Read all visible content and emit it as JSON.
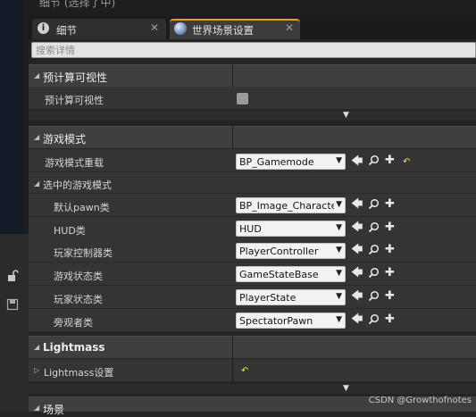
{
  "window": {
    "title_fragment": "细节 (选择了中)"
  },
  "tabs": [
    {
      "label": "细节",
      "icon": "info-icon"
    },
    {
      "label": "世界场景设置",
      "icon": "globe-icon"
    }
  ],
  "search": {
    "placeholder": "搜索详情"
  },
  "sections": {
    "precomputed": {
      "title": "预计算可视性",
      "rows": [
        {
          "label": "预计算可视性",
          "checked": false
        }
      ]
    },
    "game_mode": {
      "title": "游戏模式",
      "override_label": "游戏模式重载",
      "override_value": "BP_Gamemode",
      "selected_label": "选中的游戏模式",
      "rows": [
        {
          "label": "默认pawn类",
          "value": "BP_Image_Character"
        },
        {
          "label": "HUD类",
          "value": "HUD"
        },
        {
          "label": "玩家控制器类",
          "value": "PlayerController"
        },
        {
          "label": "游戏状态类",
          "value": "GameStateBase"
        },
        {
          "label": "玩家状态类",
          "value": "PlayerState"
        },
        {
          "label": "旁观者类",
          "value": "SpectatorPawn"
        }
      ]
    },
    "lightmass": {
      "title": "Lightmass",
      "settings_label": "Lightmass设置"
    },
    "scene": {
      "title": "场景"
    }
  },
  "watermark": "CSDN @Growthofnotes",
  "colors": {
    "tab_active_accent": "#e0a500",
    "reset_icon": "#f0e24b"
  }
}
